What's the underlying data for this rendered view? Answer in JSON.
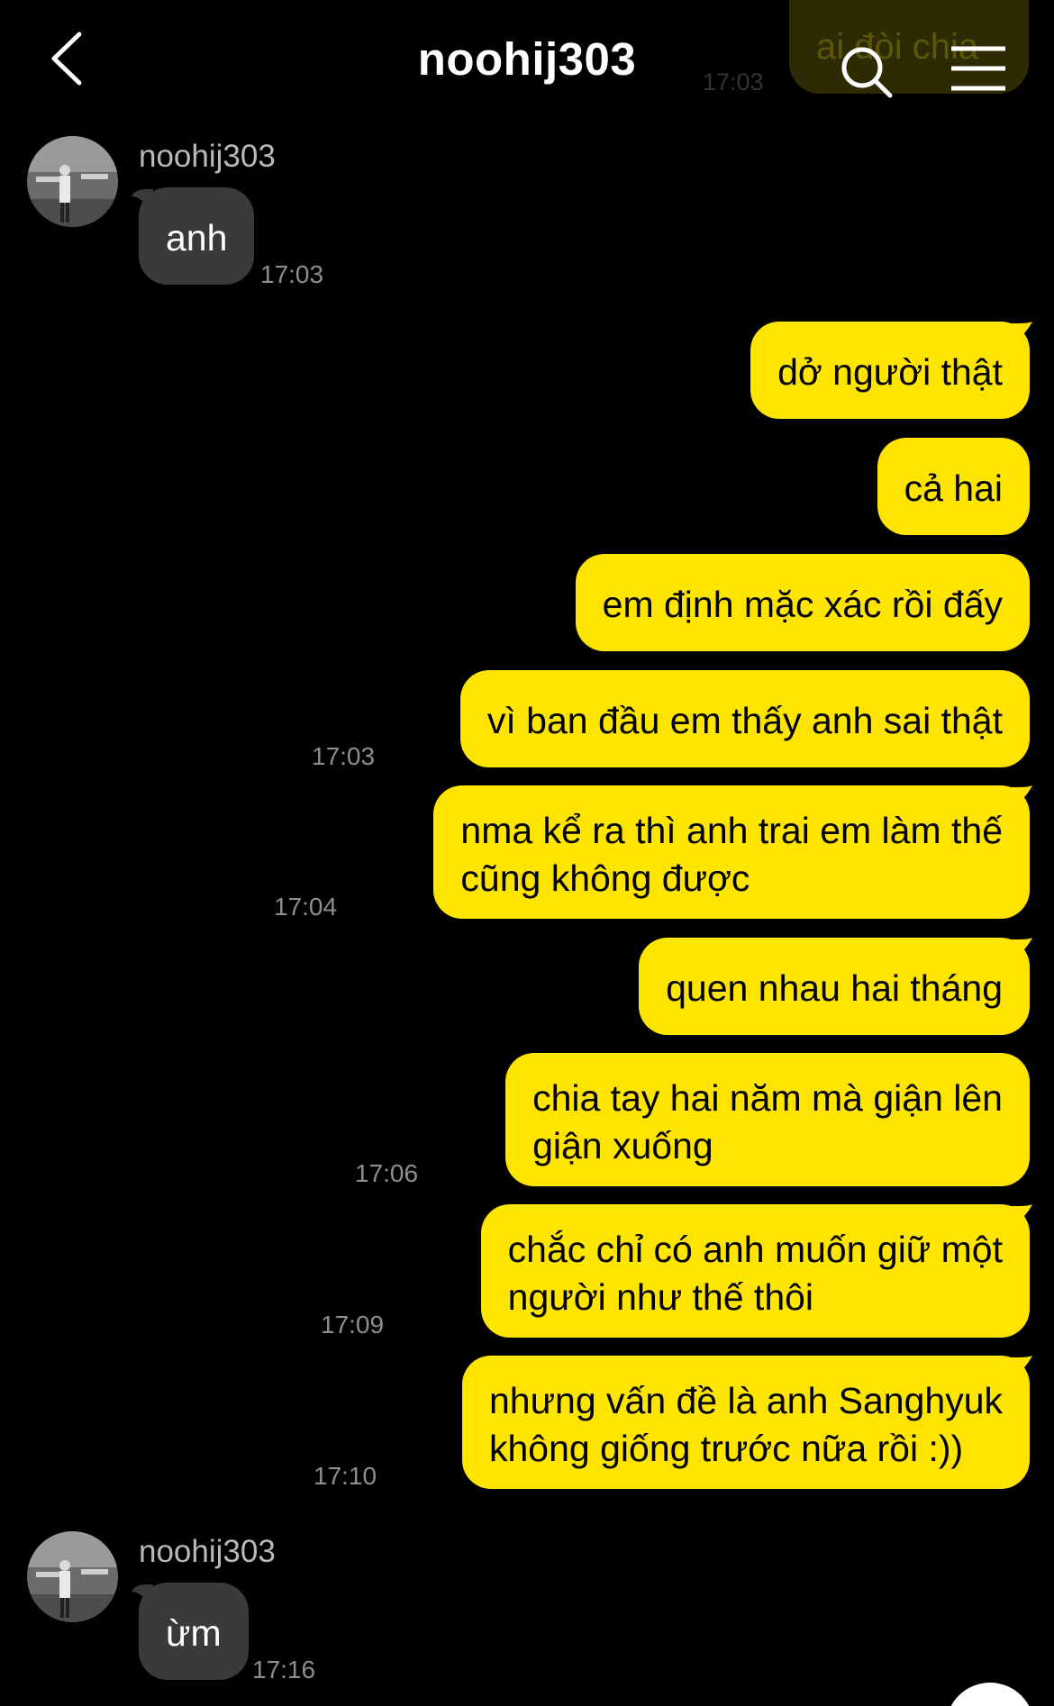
{
  "header": {
    "title": "noohij303",
    "back_icon": "chevron-left-icon",
    "search_icon": "search-icon",
    "menu_icon": "hamburger-menu-icon"
  },
  "ghost_message": {
    "text": "ai đòi chia",
    "time": "17:03"
  },
  "colors": {
    "background": "#000000",
    "outgoing_bubble": "#fee500",
    "incoming_bubble": "#3a3a3a",
    "timestamp": "#8e8e8e",
    "sender_name": "#b8b8b8"
  },
  "messages": [
    {
      "sender": "noohij303",
      "text": "anh",
      "time": "17:03"
    },
    {
      "text": "dở người thật"
    },
    {
      "text": "cả hai"
    },
    {
      "text": "em định mặc xác rồi đấy"
    },
    {
      "text": "vì ban đầu em thấy anh sai thật",
      "time": "17:03"
    },
    {
      "text": "nma kể ra thì anh trai em làm thế\ncũng không được",
      "time": "17:04"
    },
    {
      "text": "quen nhau hai tháng"
    },
    {
      "text": "chia tay hai năm mà giận lên\ngiận xuống",
      "time": "17:06"
    },
    {
      "text": "chắc chỉ có anh muốn giữ một\nngười như thế thôi",
      "time": "17:09"
    },
    {
      "text": "nhưng vấn đề là anh Sanghyuk\nkhông giống trước nữa rồi :))",
      "time": "17:10"
    },
    {
      "sender": "noohij303",
      "text": "ừm",
      "time": "17:16"
    }
  ]
}
